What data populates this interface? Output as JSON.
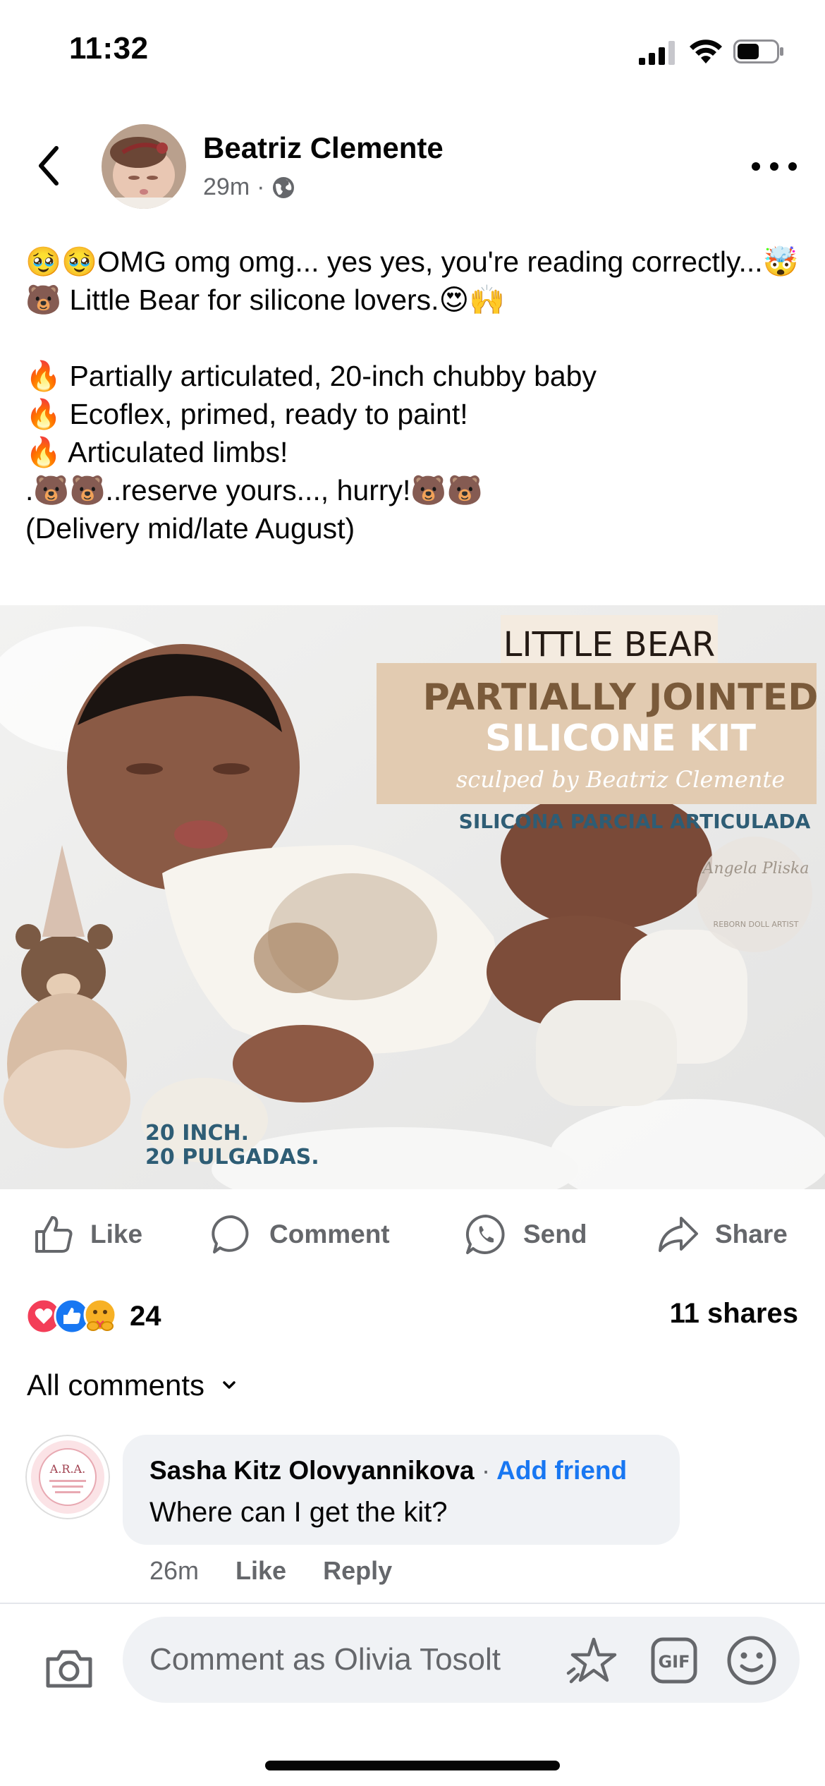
{
  "status_bar": {
    "time": "11:32",
    "icons": [
      "signal-icon",
      "wifi-icon",
      "battery-icon"
    ]
  },
  "post": {
    "author": "Beatriz Clemente",
    "time": "29m",
    "separator": "·",
    "audience_icon": "globe-icon",
    "text": "🥹🥹OMG omg omg... yes yes, you're reading correctly...🤯\n🐻 Little Bear for silicone lovers.😍🙌\n\n🔥 Partially articulated, 20-inch chubby baby\n🔥 Ecoflex, primed, ready to paint!\n🔥 Articulated limbs!\n.🐻🐻..reserve yours..., hurry!🐻🐻\n(Delivery mid/late August)",
    "image": {
      "title": "LITTLE BEAR",
      "subtitle_line1": "PARTIALLY JOINTED",
      "subtitle_line2": "SILICONE KIT",
      "sculpted_by": "sculped by Beatriz Clemente",
      "spanish": "SILICONA PARCIAL ARTICULADA",
      "watermark": "Angela Pliska",
      "watermark_sub": "REBORN DOLL ARTIST",
      "size_line1": "20 INCH.",
      "size_line2": "20 PULGADAS."
    }
  },
  "actions": {
    "like": "Like",
    "comment": "Comment",
    "send": "Send",
    "share": "Share"
  },
  "reactions": {
    "types": [
      "love",
      "like",
      "care"
    ],
    "count": "24",
    "shares": "11 shares"
  },
  "comments_filter": "All comments",
  "comment": {
    "author": "Sasha Kitz Olovyannikova",
    "separator": "·",
    "add_friend": "Add friend",
    "text": "Where can I get the kit?",
    "time": "26m",
    "like": "Like",
    "reply": "Reply",
    "avatar_text": "A.R.A."
  },
  "composer": {
    "placeholder": "Comment as Olivia Tosolt",
    "gif_label": "GIF"
  },
  "colors": {
    "accent": "#1877f2",
    "secondary_text": "#65676b",
    "bubble": "#f0f2f5",
    "banner": "#e2cbb1",
    "title_brown": "#7a5a3a"
  }
}
